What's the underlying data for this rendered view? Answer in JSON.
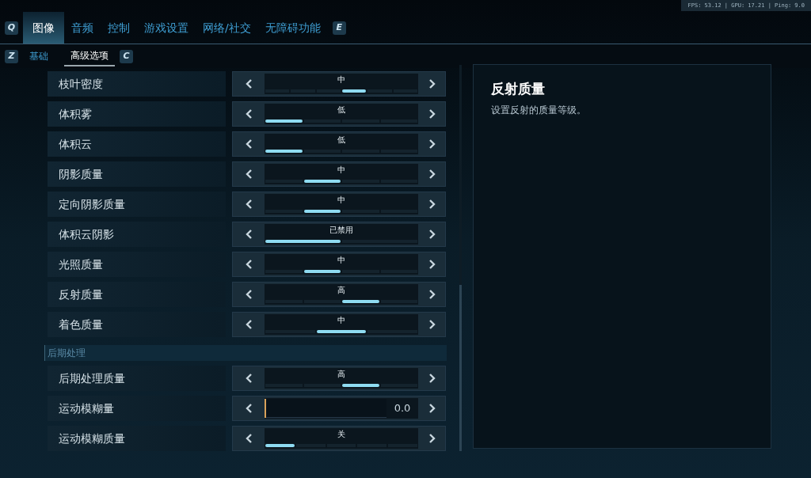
{
  "perf_overlay": "FPS: 53.12 | GPU: 17.21 | Ping: 9.0",
  "tabs": {
    "prev_key": "Q",
    "next_key": "E",
    "items": [
      {
        "label": "图像",
        "selected": true
      },
      {
        "label": "音频",
        "selected": false
      },
      {
        "label": "控制",
        "selected": false
      },
      {
        "label": "游戏设置",
        "selected": false
      },
      {
        "label": "网络/社交",
        "selected": false
      },
      {
        "label": "无障碍功能",
        "selected": false
      }
    ]
  },
  "subtabs": {
    "prev_key": "Z",
    "next_key": "C",
    "items": [
      {
        "label": "基础",
        "selected": false
      },
      {
        "label": "高级选项",
        "selected": true
      }
    ]
  },
  "settings": [
    {
      "kind": "stepper",
      "label": "枝叶密度",
      "value": "中",
      "segments": [
        {
          "selected": false
        },
        {
          "selected": false
        },
        {
          "selected": false
        },
        {
          "selected": true
        },
        {
          "selected": false
        },
        {
          "selected": false
        }
      ]
    },
    {
      "kind": "stepper",
      "label": "体积雾",
      "value": "低",
      "segments": [
        {
          "selected": true
        },
        {
          "selected": false
        },
        {
          "selected": false
        },
        {
          "selected": false
        }
      ]
    },
    {
      "kind": "stepper",
      "label": "体积云",
      "value": "低",
      "segments": [
        {
          "selected": true
        },
        {
          "selected": false
        },
        {
          "selected": false
        },
        {
          "selected": false
        }
      ]
    },
    {
      "kind": "stepper",
      "label": "阴影质量",
      "value": "中",
      "segments": [
        {
          "selected": false
        },
        {
          "selected": true
        },
        {
          "selected": false
        },
        {
          "selected": false
        }
      ]
    },
    {
      "kind": "stepper",
      "label": "定向阴影质量",
      "value": "中",
      "segments": [
        {
          "selected": false
        },
        {
          "selected": true
        },
        {
          "selected": false
        },
        {
          "selected": false
        }
      ]
    },
    {
      "kind": "stepper",
      "label": "体积云阴影",
      "value": "已禁用",
      "segments": [
        {
          "selected": true
        },
        {
          "selected": false
        }
      ]
    },
    {
      "kind": "stepper",
      "label": "光照质量",
      "value": "中",
      "segments": [
        {
          "selected": false
        },
        {
          "selected": true
        },
        {
          "selected": false
        },
        {
          "selected": false
        }
      ]
    },
    {
      "kind": "stepper",
      "label": "反射质量",
      "value": "高",
      "segments": [
        {
          "selected": false
        },
        {
          "selected": false
        },
        {
          "selected": true
        },
        {
          "selected": false
        }
      ]
    },
    {
      "kind": "stepper",
      "label": "着色质量",
      "value": "中",
      "segments": [
        {
          "selected": false
        },
        {
          "selected": true
        },
        {
          "selected": false
        }
      ]
    },
    {
      "kind": "section",
      "label": "后期处理"
    },
    {
      "kind": "stepper",
      "label": "后期处理质量",
      "value": "高",
      "segments": [
        {
          "selected": false
        },
        {
          "selected": false
        },
        {
          "selected": true
        },
        {
          "selected": false
        }
      ]
    },
    {
      "kind": "slider",
      "label": "运动模糊量",
      "value": "0.0",
      "level": 0
    },
    {
      "kind": "stepper",
      "label": "运动模糊质量",
      "value": "关",
      "segments": [
        {
          "selected": true
        },
        {
          "selected": false
        },
        {
          "selected": false
        },
        {
          "selected": false
        },
        {
          "selected": false
        }
      ]
    }
  ],
  "description": {
    "title": "反射质量",
    "text": "设置反射的质量等级。"
  }
}
